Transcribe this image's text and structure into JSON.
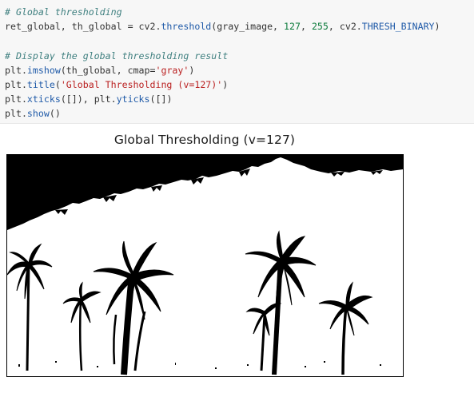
{
  "code_cell": {
    "lines": [
      {
        "comment": "# Global thresholding"
      },
      {
        "a": "ret_global, th_global ",
        "b": "=",
        "c": " cv2.",
        "d": "threshold",
        "e": "(gray_image, ",
        "f": "127",
        "g": ", ",
        "h": "255",
        "i": ", cv2.",
        "j": "THRESH_BINARY",
        "k": ")"
      },
      {
        "blank": ""
      },
      {
        "comment": "# Display the global thresholding result"
      },
      {
        "a": "plt.",
        "b": "imshow",
        "c": "(th_global, cmap=",
        "d": "'gray'",
        "e": ")"
      },
      {
        "a": "plt.",
        "b": "title",
        "c": "(",
        "d": "'Global Thresholding (v=127)'",
        "e": ")"
      },
      {
        "a": "plt.",
        "b": "xticks",
        "c": "([]), plt.",
        "d": "yticks",
        "e": "([])"
      },
      {
        "a": "plt.",
        "b": "show",
        "c": "()"
      }
    ]
  },
  "output": {
    "figure_title": "Global Thresholding (v=127)",
    "image_description_colors": {
      "foreground": "#000000",
      "background": "#ffffff"
    }
  }
}
